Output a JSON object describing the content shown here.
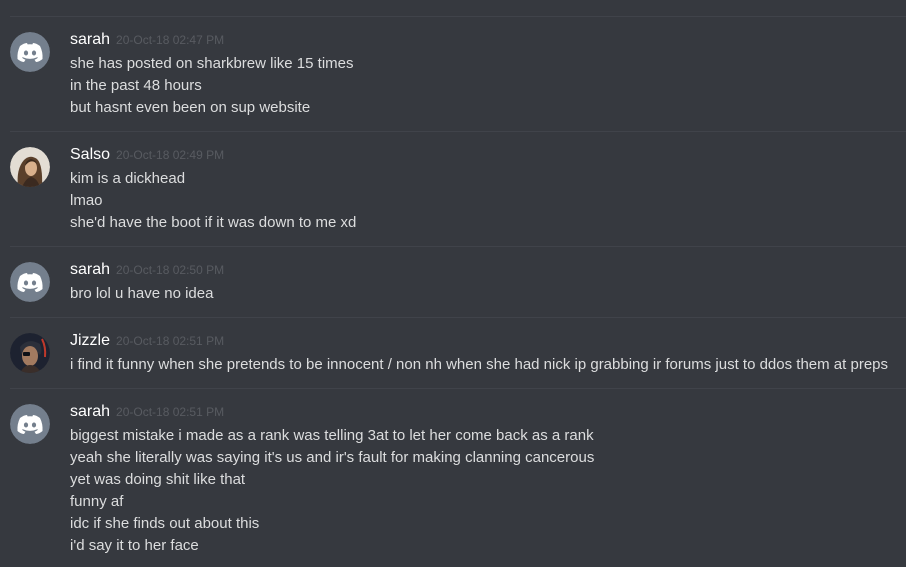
{
  "messages": [
    {
      "avatar": "discord-default-avatar",
      "username": "sarah",
      "timestamp": "20-Oct-18 02:47 PM",
      "lines": [
        "she has posted on sharkbrew like 15 times",
        "in the past 48 hours",
        "but hasnt even been on sup website"
      ]
    },
    {
      "avatar": "user-photo-avatar",
      "username": "Salso",
      "timestamp": "20-Oct-18 02:49 PM",
      "lines": [
        "kim is a dickhead",
        "lmao",
        "she'd have the boot if it was down to me xd"
      ]
    },
    {
      "avatar": "discord-default-avatar",
      "username": "sarah",
      "timestamp": "20-Oct-18 02:50 PM",
      "lines": [
        "bro lol u have no idea"
      ]
    },
    {
      "avatar": "user-photo-avatar",
      "username": "Jizzle",
      "timestamp": "20-Oct-18 02:51 PM",
      "lines": [
        "i find it funny when she pretends to be innocent / non nh when she had nick ip grabbing ir forums just to ddos them at preps"
      ]
    },
    {
      "avatar": "discord-default-avatar",
      "username": "sarah",
      "timestamp": "20-Oct-18 02:51 PM",
      "lines": [
        "biggest mistake i made as a rank was telling 3at to let her come back as a rank",
        "yeah she literally was saying it's us and ir's fault for making clanning cancerous",
        "yet was doing shit like that",
        "funny af",
        "idc if she finds out about this",
        "i'd say it to her face"
      ]
    }
  ],
  "colors": {
    "background": "#36393f",
    "username": "#ffffff",
    "timestamp": "#585b61",
    "message_text": "#dcddde",
    "divider": "#40434a",
    "default_avatar_bg": "#747f8d"
  }
}
